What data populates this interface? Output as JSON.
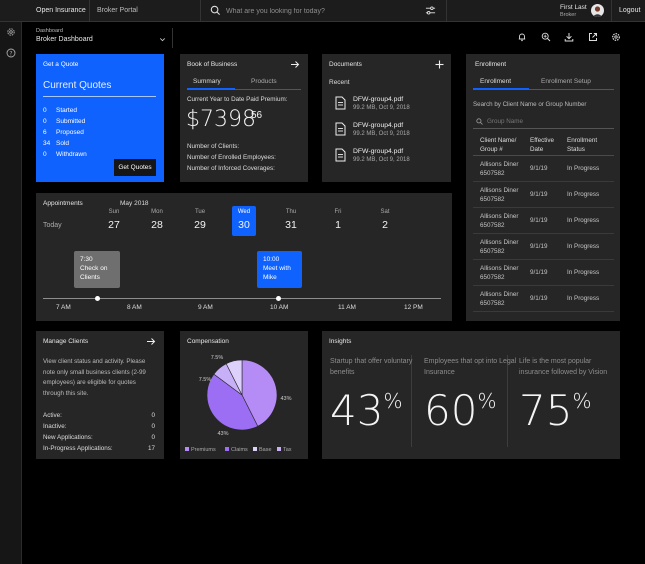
{
  "topbar": {
    "brand": "Open Insurance",
    "portal": "Broker Portal",
    "search_placeholder": "What are you looking for today?",
    "user_name": "First Last",
    "user_role": "Broker",
    "logout": "Logout"
  },
  "subheader": {
    "breadcrumb": "Dashboard",
    "title": "Broker Dashboard"
  },
  "quote": {
    "header": "Get a Quote",
    "title": "Current Quotes",
    "rows": [
      {
        "count": "0",
        "label": "Started"
      },
      {
        "count": "0",
        "label": "Submitted"
      },
      {
        "count": "6",
        "label": "Proposed"
      },
      {
        "count": "34",
        "label": "Sold"
      },
      {
        "count": "0",
        "label": "Withdrawn"
      }
    ],
    "button": "Get Quotes"
  },
  "book": {
    "title": "Book of Business",
    "tab_summary": "Summary",
    "tab_products": "Products",
    "premium_label": "Current Year to Date Paid Premium:",
    "premium_main": "$7398",
    "premium_cents": "56",
    "stats": [
      "Number of Clients:",
      "Number of Enrolled Employees:",
      "Number of Inforced Coverages:"
    ]
  },
  "documents": {
    "title": "Documents",
    "recent": "Recent",
    "files": [
      {
        "name": "DFW-group4.pdf",
        "meta": "99.2 MB, Oct 9, 2018"
      },
      {
        "name": "DFW-group4.pdf",
        "meta": "99.2 MB, Oct 9, 2018"
      },
      {
        "name": "DFW-group4.pdf",
        "meta": "99.2 MB, Oct 9, 2018"
      }
    ]
  },
  "enrollment": {
    "title": "Enrollment",
    "tab_enrollment": "Enrollment",
    "tab_setup": "Enrollment Setup",
    "search_label": "Search by Client Name or Group Number",
    "search_placeholder": "Group Name",
    "col_client": "Client Name/ Group #",
    "col_date": "Effective Date",
    "col_status": "Enrollment Status",
    "rows": [
      {
        "name": "Allisons Diner",
        "group": "6507582",
        "date": "9/1/19",
        "status": "In Progress"
      },
      {
        "name": "Allisons Diner",
        "group": "6507582",
        "date": "9/1/19",
        "status": "In Progress"
      },
      {
        "name": "Allisons Diner",
        "group": "6507582",
        "date": "9/1/19",
        "status": "In Progress"
      },
      {
        "name": "Allisons Diner",
        "group": "6507582",
        "date": "9/1/19",
        "status": "In Progress"
      },
      {
        "name": "Allisons Diner",
        "group": "6507582",
        "date": "9/1/19",
        "status": "In Progress"
      },
      {
        "name": "Allisons Diner",
        "group": "6507582",
        "date": "9/1/19",
        "status": "In Progress"
      }
    ]
  },
  "appointments": {
    "title": "Appointments",
    "month": "May 2018",
    "today": "Today",
    "days": [
      {
        "name": "Sun",
        "date": "27"
      },
      {
        "name": "Mon",
        "date": "28"
      },
      {
        "name": "Tue",
        "date": "29"
      },
      {
        "name": "Wed",
        "date": "30"
      },
      {
        "name": "Thu",
        "date": "31"
      },
      {
        "name": "Fri",
        "date": "1"
      },
      {
        "name": "Sat",
        "date": "2"
      }
    ],
    "events": [
      {
        "time": "7:30",
        "line1": "Check on",
        "line2": "Clients"
      },
      {
        "time": "10:00",
        "line1": "Meet with",
        "line2": "Mike"
      }
    ],
    "times": [
      "7 AM",
      "8 AM",
      "9 AM",
      "10 AM",
      "11 AM",
      "12 PM"
    ]
  },
  "clients": {
    "title": "Manage Clients",
    "description": [
      "View client status and activity. Please",
      "note only small business clients (2-99",
      "employees) are eligible for quotes",
      "through this site."
    ],
    "stats": [
      {
        "label": "Active:",
        "value": "0"
      },
      {
        "label": "Inactive:",
        "value": "0"
      },
      {
        "label": "New Applications:",
        "value": "0"
      },
      {
        "label": "In-Progress Applications:",
        "value": "17"
      }
    ]
  },
  "compensation": {
    "title": "Compensation"
  },
  "chart_data": {
    "type": "pie",
    "title": "",
    "series": [
      {
        "name": "Premiums",
        "value": 43,
        "label": "43%",
        "color": "#b58cf6"
      },
      {
        "name": "Claims",
        "value": 43,
        "label": "43%",
        "color": "#9b6ef3"
      },
      {
        "name": "Base",
        "value": 7.5,
        "label": "7.5%",
        "color": "#ddd0fb"
      },
      {
        "name": "Tax",
        "value": 7.5,
        "label": "7.5%",
        "color": "#c8b0f8"
      }
    ],
    "legend": "bottom"
  },
  "insights": {
    "title": "Insights",
    "items": [
      {
        "text": "Startup that offer voluntary benefits",
        "value": "43",
        "unit": "%"
      },
      {
        "text": "Employees that opt into Legal Insurance",
        "value": "60",
        "unit": "%"
      },
      {
        "text": "Life is the most popular insurance followed by Vision",
        "value": "75",
        "unit": "%"
      }
    ]
  },
  "colors": {
    "accent": "#0f62fe",
    "card": "#262626",
    "event_gray": "#6f6f6f",
    "pie_primary": "#a56eff"
  }
}
